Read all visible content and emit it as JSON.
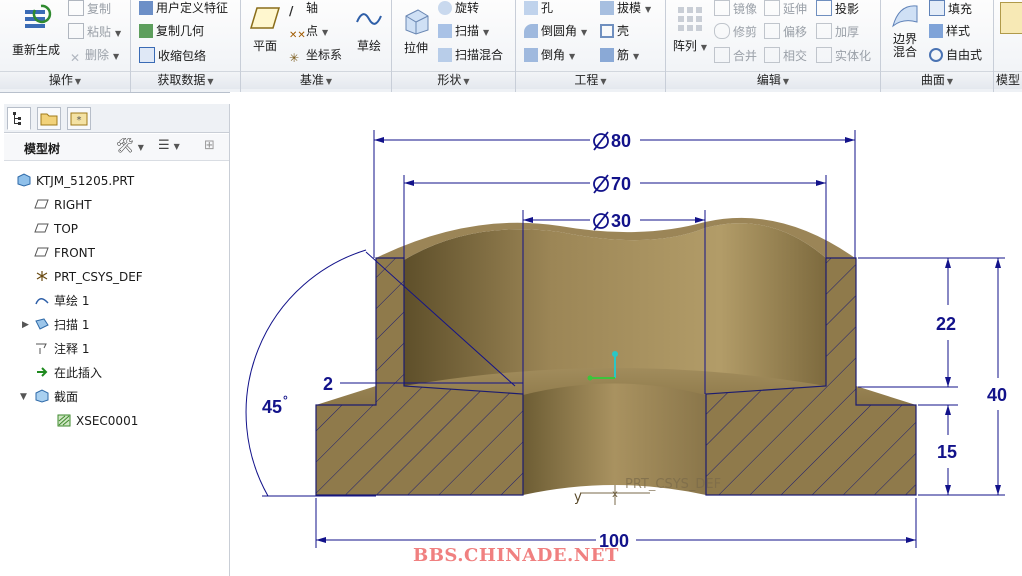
{
  "ribbon": {
    "groups": {
      "operations": {
        "label": "操作",
        "regen": "重新生成",
        "copy": "复制",
        "paste": "粘贴",
        "delete": "删除"
      },
      "get_data": {
        "label": "获取数据",
        "udf": "用户定义特征",
        "copy_geom": "复制几何",
        "shrinkwrap": "收缩包络"
      },
      "datum": {
        "label": "基准",
        "plane": "平面",
        "axis": "轴",
        "point": "点",
        "csys": "坐标系",
        "sketch": "草绘"
      },
      "shapes": {
        "label": "形状",
        "extrude": "拉伸",
        "revolve": "旋转",
        "sweep": "扫描",
        "swept_blend": "扫描混合"
      },
      "engineering": {
        "label": "工程",
        "hole": "孔",
        "round": "倒圆角",
        "chamfer": "倒角",
        "draft": "拔模",
        "shell": "壳",
        "rib": "筋"
      },
      "editing": {
        "label": "编辑",
        "pattern": "阵列",
        "mirror": "镜像",
        "trim": "修剪",
        "merge": "合并",
        "extend": "延伸",
        "offset": "偏移",
        "intersect": "相交",
        "project": "投影",
        "thicken": "加厚",
        "solidify": "实体化"
      },
      "surfaces": {
        "label": "曲面",
        "boundary_blend": "边界混合",
        "fill": "填充",
        "style": "样式",
        "freestyle": "自由式"
      },
      "model_intent": {
        "label": "模型"
      }
    }
  },
  "model_tree": {
    "title": "模型树",
    "items": [
      {
        "label": "KTJM_51205.PRT",
        "icon": "part-icon"
      },
      {
        "label": "RIGHT",
        "icon": "datum-plane-icon"
      },
      {
        "label": "TOP",
        "icon": "datum-plane-icon"
      },
      {
        "label": "FRONT",
        "icon": "datum-plane-icon"
      },
      {
        "label": "PRT_CSYS_DEF",
        "icon": "csys-icon"
      },
      {
        "label": "草绘 1",
        "icon": "sketch-icon"
      },
      {
        "label": "扫描 1",
        "icon": "sweep-icon"
      },
      {
        "label": "注释 1",
        "icon": "annotation-icon"
      },
      {
        "label": "在此插入",
        "icon": "insert-here-icon"
      },
      {
        "label": "截面",
        "icon": "section-icon"
      },
      {
        "label": "XSEC0001",
        "icon": "xsec-icon"
      }
    ]
  },
  "drawing": {
    "dims": {
      "d80": "80",
      "d70": "70",
      "d30": "30",
      "h22": "22",
      "h40": "40",
      "h15": "15",
      "w100": "100",
      "t2": "2",
      "a45": "45"
    },
    "csys_label": "PRT_CSYS_DEF",
    "axis_y": "y",
    "colors": {
      "solid": "#9a8455",
      "dim": "#12128a",
      "hatch_line": "#1c1c70"
    }
  },
  "watermark": "BBS.CHINADE.NET"
}
